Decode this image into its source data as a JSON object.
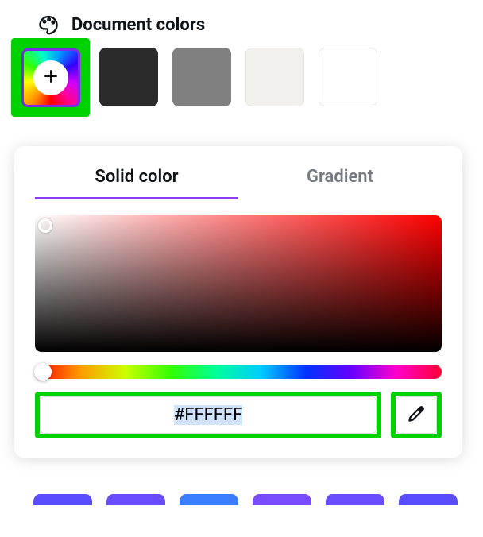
{
  "header": {
    "title": "Document colors"
  },
  "swatches": {
    "items": [
      {
        "name": "dark",
        "color": "#2b2b2b"
      },
      {
        "name": "gray",
        "color": "#808080"
      },
      {
        "name": "off",
        "color": "#f1f0ed"
      },
      {
        "name": "white",
        "color": "#ffffff"
      }
    ]
  },
  "picker": {
    "tabs": {
      "solid": "Solid color",
      "gradient": "Gradient",
      "active": "solid"
    },
    "hue": 0,
    "hex_value": "#FFFFFF"
  },
  "accent": "#8b3dff",
  "highlight": "#00d200",
  "bottom_peeks": [
    "#5a4cff",
    "#6a4cff",
    "#3a7dff",
    "#7a4cff",
    "#6a4cff",
    "#5a4cff"
  ]
}
